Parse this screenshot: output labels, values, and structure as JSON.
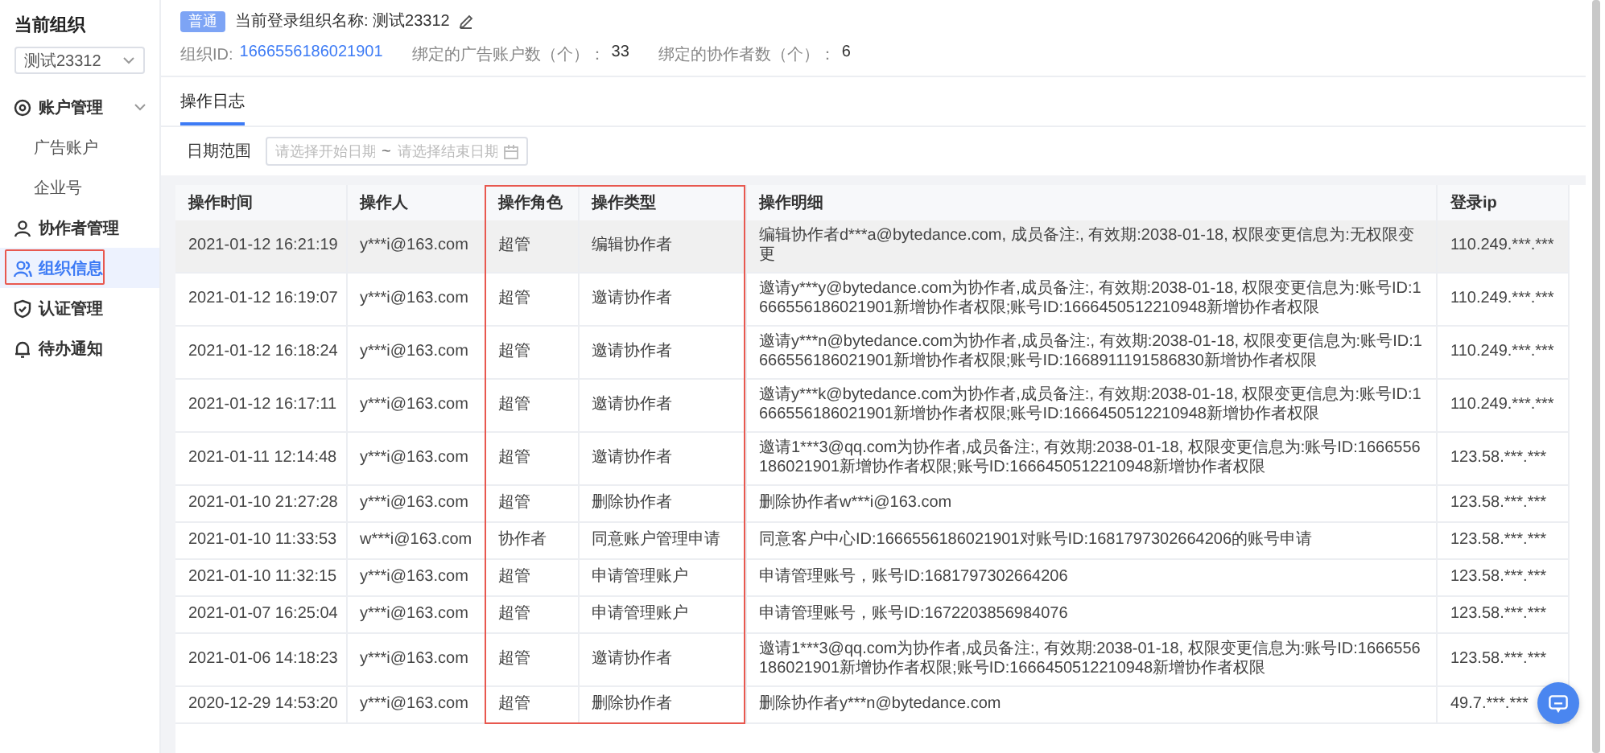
{
  "sidebar": {
    "title": "当前组织",
    "org_select": {
      "value": "测试23312"
    },
    "items": [
      {
        "label": "账户管理",
        "expanded": true,
        "selected": false,
        "highlighted": false,
        "children": [
          {
            "label": "广告账户",
            "selected": false
          },
          {
            "label": "企业号",
            "selected": false
          }
        ]
      },
      {
        "label": "协作者管理",
        "selected": false,
        "highlighted": false
      },
      {
        "label": "组织信息",
        "selected": true,
        "highlighted": true
      },
      {
        "label": "认证管理",
        "selected": false,
        "highlighted": false
      },
      {
        "label": "待办通知",
        "selected": false,
        "highlighted": false
      }
    ]
  },
  "header": {
    "badge": "普通",
    "org_name": "当前登录组织名称: 测试23312",
    "stats": [
      {
        "label": "组织ID:",
        "value": "1666556186021901",
        "kind": "link"
      },
      {
        "label": "绑定的广告账户数（个）：",
        "value": "33",
        "kind": "plain"
      },
      {
        "label": "绑定的协作者数（个）：",
        "value": "6",
        "kind": "plain"
      }
    ]
  },
  "tabs": [
    {
      "label": "操作日志",
      "selected": true
    }
  ],
  "filter": {
    "label": "日期范围",
    "start": {
      "placeholder": "请选择开始日期"
    },
    "separator": "~",
    "end": {
      "placeholder": "请选择结束日期"
    }
  },
  "table": {
    "columns": [
      {
        "label": "操作时间",
        "highlighted": false
      },
      {
        "label": "操作人",
        "highlighted": false
      },
      {
        "label": "操作角色",
        "highlighted": true
      },
      {
        "label": "操作类型",
        "highlighted": true
      },
      {
        "label": "操作明细",
        "highlighted": false
      },
      {
        "label": "登录ip",
        "highlighted": false
      }
    ],
    "rows": [
      {
        "hovered": true,
        "cells": [
          "2021-01-12 16:21:19",
          "y***i@163.com",
          "超管",
          "编辑协作者",
          "编辑协作者d***a@bytedance.com, 成员备注:, 有效期:2038-01-18, 权限变更信息为:无权限变更",
          "110.249.***.***"
        ]
      },
      {
        "hovered": false,
        "cells": [
          "2021-01-12 16:19:07",
          "y***i@163.com",
          "超管",
          "邀请协作者",
          "邀请y***y@bytedance.com为协作者,成员备注:, 有效期:2038-01-18, 权限变更信息为:账号ID:1666556186021901新增协作者权限;账号ID:1666450512210948新增协作者权限",
          "110.249.***.***"
        ]
      },
      {
        "hovered": false,
        "cells": [
          "2021-01-12 16:18:24",
          "y***i@163.com",
          "超管",
          "邀请协作者",
          "邀请y***n@bytedance.com为协作者,成员备注:, 有效期:2038-01-18, 权限变更信息为:账号ID:1666556186021901新增协作者权限;账号ID:1668911191586830新增协作者权限",
          "110.249.***.***"
        ]
      },
      {
        "hovered": false,
        "cells": [
          "2021-01-12 16:17:11",
          "y***i@163.com",
          "超管",
          "邀请协作者",
          "邀请y***k@bytedance.com为协作者,成员备注:, 有效期:2038-01-18, 权限变更信息为:账号ID:1666556186021901新增协作者权限;账号ID:1666450512210948新增协作者权限",
          "110.249.***.***"
        ]
      },
      {
        "hovered": false,
        "cells": [
          "2021-01-11 12:14:48",
          "y***i@163.com",
          "超管",
          "邀请协作者",
          "邀请1***3@qq.com为协作者,成员备注:, 有效期:2038-01-18, 权限变更信息为:账号ID:1666556186021901新增协作者权限;账号ID:1666450512210948新增协作者权限",
          "123.58.***.***"
        ]
      },
      {
        "hovered": false,
        "cells": [
          "2021-01-10 21:27:28",
          "y***i@163.com",
          "超管",
          "删除协作者",
          "删除协作者w***i@163.com",
          "123.58.***.***"
        ]
      },
      {
        "hovered": false,
        "cells": [
          "2021-01-10 11:33:53",
          "w***i@163.com",
          "协作者",
          "同意账户管理申请",
          "同意客户中心ID:1666556186021901对账号ID:1681797302664206的账号申请",
          "123.58.***.***"
        ]
      },
      {
        "hovered": false,
        "cells": [
          "2021-01-10 11:32:15",
          "y***i@163.com",
          "超管",
          "申请管理账户",
          "申请管理账号，账号ID:1681797302664206",
          "123.58.***.***"
        ]
      },
      {
        "hovered": false,
        "cells": [
          "2021-01-07 16:25:04",
          "y***i@163.com",
          "超管",
          "申请管理账户",
          "申请管理账号，账号ID:1672203856984076",
          "123.58.***.***"
        ]
      },
      {
        "hovered": false,
        "cells": [
          "2021-01-06 14:18:23",
          "y***i@163.com",
          "超管",
          "邀请协作者",
          "邀请1***3@qq.com为协作者,成员备注:, 有效期:2038-01-18, 权限变更信息为:账号ID:1666556186021901新增协作者权限;账号ID:1666450512210948新增协作者权限",
          "123.58.***.***"
        ]
      },
      {
        "hovered": false,
        "cells": [
          "2020-12-29 14:53:20",
          "y***i@163.com",
          "超管",
          "删除协作者",
          "删除协作者y***n@bytedance.com",
          "49.7.***.***"
        ]
      }
    ]
  }
}
